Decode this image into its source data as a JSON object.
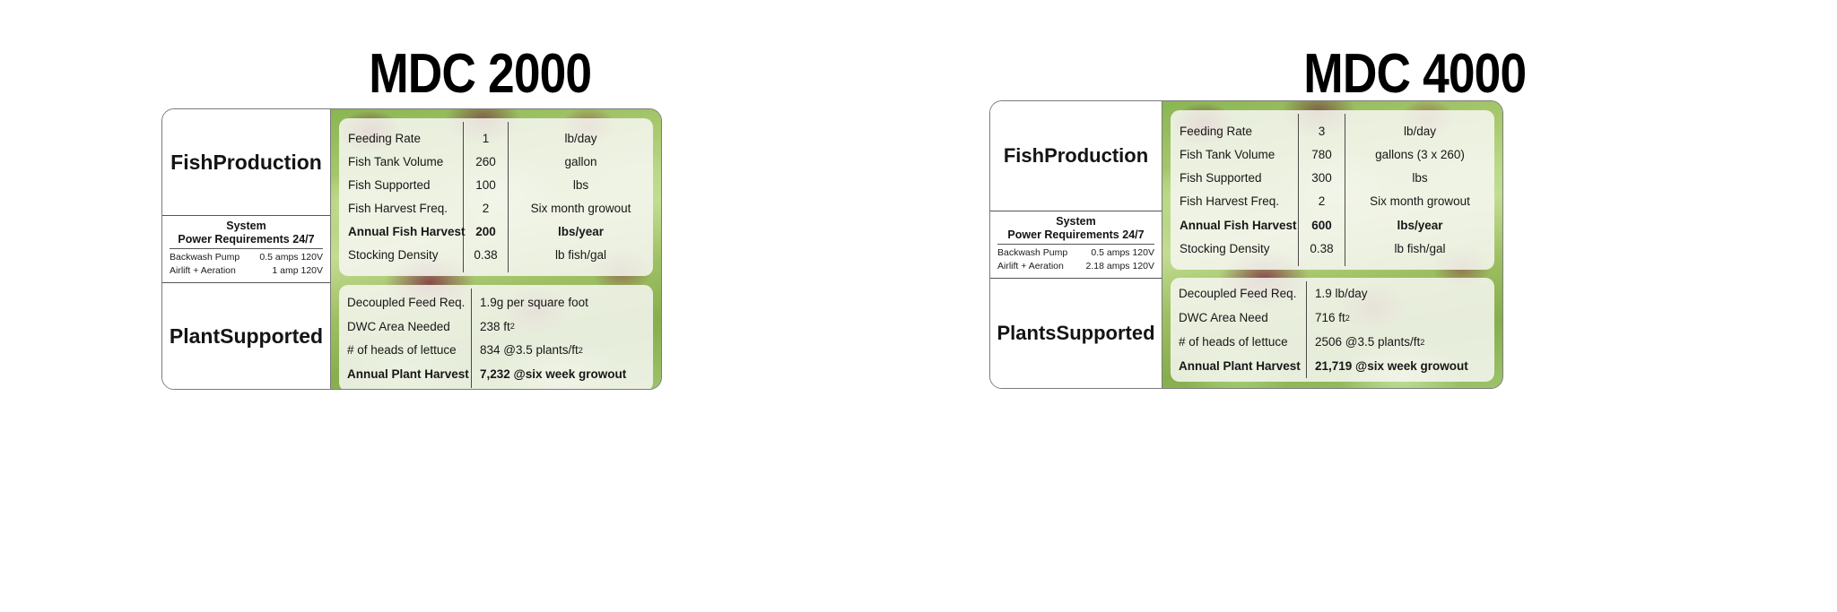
{
  "products": [
    {
      "title": "MDC 2000",
      "label_top": "Fish\nProduction",
      "label_bottom": "Plant\nSupported",
      "power": {
        "title_line1": "System",
        "title_line2": "Power Requirements 24/7",
        "rows": [
          {
            "name": "Backwash Pump",
            "value": "0.5 amps 120V"
          },
          {
            "name": "Airlift + Aeration",
            "value": "1 amp 120V"
          }
        ]
      },
      "fish_table": {
        "rows": [
          {
            "name": "Feeding Rate",
            "value": "1",
            "unit": "lb/day",
            "bold": false
          },
          {
            "name": "Fish Tank Volume",
            "value": "260",
            "unit": "gallon",
            "bold": false
          },
          {
            "name": "Fish Supported",
            "value": "100",
            "unit": "lbs",
            "bold": false
          },
          {
            "name": "Fish Harvest Freq.",
            "value": "2",
            "unit": "Six month growout",
            "bold": false
          },
          {
            "name": "Annual Fish Harvest",
            "value": "200",
            "unit": "lbs/year",
            "bold": true
          },
          {
            "name": "Stocking Density",
            "value": "0.38",
            "unit": "lb fish/gal",
            "bold": false
          }
        ]
      },
      "plant_table": {
        "rows": [
          {
            "name": "Decoupled Feed Req.",
            "value": "1.9g per square foot",
            "bold": false
          },
          {
            "name": "DWC  Area  Needed",
            "value": "238 ft²",
            "bold": false
          },
          {
            "name": "# of heads of lettuce",
            "value": "834  @3.5 plants/ft²",
            "bold": false
          },
          {
            "name": "Annual Plant Harvest",
            "value": "7,232 @six week growout",
            "bold": true
          }
        ]
      }
    },
    {
      "title": "MDC 4000",
      "label_top": "Fish\nProduction",
      "label_bottom": "Plants\nSupported",
      "power": {
        "title_line1": "System",
        "title_line2": "Power Requirements 24/7",
        "rows": [
          {
            "name": "Backwash Pump",
            "value": "0.5 amps 120V"
          },
          {
            "name": "Airlift + Aeration",
            "value": "2.18 amps 120V"
          }
        ]
      },
      "fish_table": {
        "rows": [
          {
            "name": "Feeding Rate",
            "value": "3",
            "unit": "lb/day",
            "bold": false
          },
          {
            "name": "Fish Tank Volume",
            "value": "780",
            "unit": "gallons  (3 x 260)",
            "bold": false
          },
          {
            "name": "Fish Supported",
            "value": "300",
            "unit": "lbs",
            "bold": false
          },
          {
            "name": "Fish Harvest Freq.",
            "value": "2",
            "unit": "Six month growout",
            "bold": false
          },
          {
            "name": "Annual Fish Harvest",
            "value": "600",
            "unit": "lbs/year",
            "bold": true
          },
          {
            "name": "Stocking Density",
            "value": "0.38",
            "unit": "lb fish/gal",
            "bold": false
          }
        ]
      },
      "plant_table": {
        "rows": [
          {
            "name": "Decoupled Feed Req.",
            "value": "1.9 lb/day",
            "bold": false
          },
          {
            "name": "DWC Area Need",
            "value": "716 ft²",
            "bold": false
          },
          {
            "name": "# of heads of lettuce",
            "value": "2506  @3.5 plants/ft²",
            "bold": false
          },
          {
            "name": "Annual Plant Harvest",
            "value": "21,719 @six week growout",
            "bold": true
          }
        ]
      }
    }
  ],
  "colors": {
    "card_border": "#7b7b7b",
    "text": "#171717",
    "overlay": "rgba(247,247,242,0.86)",
    "photo_green": "#8ab552",
    "photo_chard_red": "#7a1834"
  }
}
